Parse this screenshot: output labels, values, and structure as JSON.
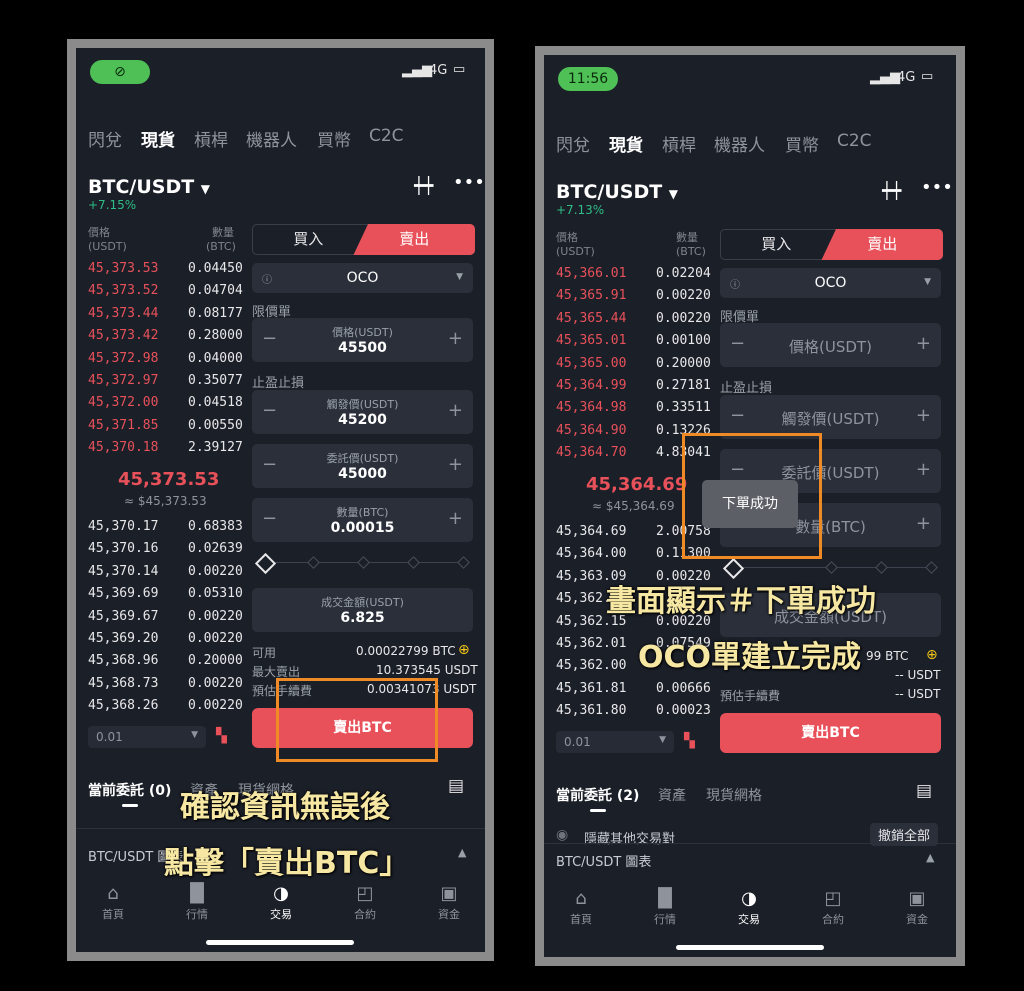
{
  "left": {
    "status": {
      "network": "4G"
    },
    "tabs": [
      "閃兌",
      "現貨",
      "槓桿",
      "機器人",
      "買幣",
      "C2C"
    ],
    "pair": "BTC/USDT",
    "change": "+7.15%",
    "ob_head": {
      "price": "價格\n(USDT)",
      "qty": "數量\n(BTC)"
    },
    "asks": [
      [
        "45,373.53",
        "0.04450"
      ],
      [
        "45,373.52",
        "0.04704"
      ],
      [
        "45,373.44",
        "0.08177"
      ],
      [
        "45,373.42",
        "0.28000"
      ],
      [
        "45,372.98",
        "0.04000"
      ],
      [
        "45,372.97",
        "0.35077"
      ],
      [
        "45,372.00",
        "0.04518"
      ],
      [
        "45,371.85",
        "0.00550"
      ],
      [
        "45,370.18",
        "2.39127"
      ]
    ],
    "mid_price": "45,373.53",
    "mid_sub": "≈ $45,373.53",
    "bids": [
      [
        "45,370.17",
        "0.68383"
      ],
      [
        "45,370.16",
        "0.02639"
      ],
      [
        "45,370.14",
        "0.00220"
      ],
      [
        "45,369.69",
        "0.05310"
      ],
      [
        "45,369.67",
        "0.00220"
      ],
      [
        "45,369.20",
        "0.00220"
      ],
      [
        "45,368.96",
        "0.20000"
      ],
      [
        "45,368.73",
        "0.00220"
      ],
      [
        "45,368.26",
        "0.00220"
      ]
    ],
    "depth": "0.01",
    "buy_label": "買入",
    "sell_label": "賣出",
    "order_type": "OCO",
    "limit_label": "限價單",
    "price_label": "價格(USDT)",
    "price_value": "45500",
    "stop_label": "止盈止損",
    "trigger_label": "觸發價(USDT)",
    "trigger_value": "45200",
    "entrust_label": "委託價(USDT)",
    "entrust_value": "45000",
    "qty_label": "數量(BTC)",
    "qty_value": "0.00015",
    "total_label": "成交金額(USDT)",
    "total_value": "6.825",
    "avail_label": "可用",
    "avail_value": "0.00022799 BTC",
    "max_label": "最大賣出",
    "max_value": "10.373545 USDT",
    "fee_label": "預估手續費",
    "fee_value": "0.00341073 USDT",
    "sell_button": "賣出BTC",
    "bottom_tabs": [
      "當前委託 (0)",
      "資產",
      "現貨網格"
    ],
    "chart_row": "BTC/USDT 圖表",
    "nav": [
      "首頁",
      "行情",
      "交易",
      "合約",
      "資金"
    ],
    "caption1": "確認資訊無誤後",
    "caption2": "點擊「賣出BTC」"
  },
  "right": {
    "status": {
      "time": "11:56",
      "network": "4G"
    },
    "tabs": [
      "閃兌",
      "現貨",
      "槓桿",
      "機器人",
      "買幣",
      "C2C"
    ],
    "pair": "BTC/USDT",
    "change": "+7.13%",
    "ob_head": {
      "price": "價格\n(USDT)",
      "qty": "數量\n(BTC)"
    },
    "asks": [
      [
        "45,366.01",
        "0.02204"
      ],
      [
        "45,365.91",
        "0.00220"
      ],
      [
        "45,365.44",
        "0.00220"
      ],
      [
        "45,365.01",
        "0.00100"
      ],
      [
        "45,365.00",
        "0.20000"
      ],
      [
        "45,364.99",
        "0.27181"
      ],
      [
        "45,364.98",
        "0.33511"
      ],
      [
        "45,364.90",
        "0.13226"
      ],
      [
        "45,364.70",
        "4.83041"
      ]
    ],
    "mid_price": "45,364.69",
    "mid_sub": "≈ $45,364.69",
    "bids": [
      [
        "45,364.69",
        "2.00758"
      ],
      [
        "45,364.00",
        "0.11300"
      ],
      [
        "45,363.09",
        "0.00220"
      ],
      [
        "45,362.63",
        ""
      ],
      [
        "45,362.15",
        "0.00220"
      ],
      [
        "45,362.01",
        "0.07549"
      ],
      [
        "45,362.00",
        ""
      ],
      [
        "45,361.81",
        "0.00666"
      ],
      [
        "45,361.80",
        "0.00023"
      ]
    ],
    "depth": "0.01",
    "buy_label": "買入",
    "sell_label": "賣出",
    "order_type": "OCO",
    "limit_label": "限價單",
    "price_ph": "價格(USDT)",
    "stop_label": "止盈止損",
    "trigger_ph": "觸發價(USDT)",
    "entrust_ph": "委託價(USDT)",
    "qty_ph": "數量(BTC)",
    "total_ph": "成交金額(USDT)",
    "avail_value": "99 BTC",
    "max_value": "-- USDT",
    "fee_label": "預估手續費",
    "fee_value": "-- USDT",
    "sell_button": "賣出BTC",
    "bottom_tabs": [
      "當前委託 (2)",
      "資產",
      "現貨網格"
    ],
    "hide_label": "隱藏其他交易對",
    "cancel_all": "撤銷全部",
    "chart_row": "BTC/USDT 圖表",
    "nav": [
      "首頁",
      "行情",
      "交易",
      "合約",
      "資金"
    ],
    "toast": "下單成功",
    "caption1": "畫面顯示＃下單成功",
    "caption2": "OCO單建立完成"
  }
}
